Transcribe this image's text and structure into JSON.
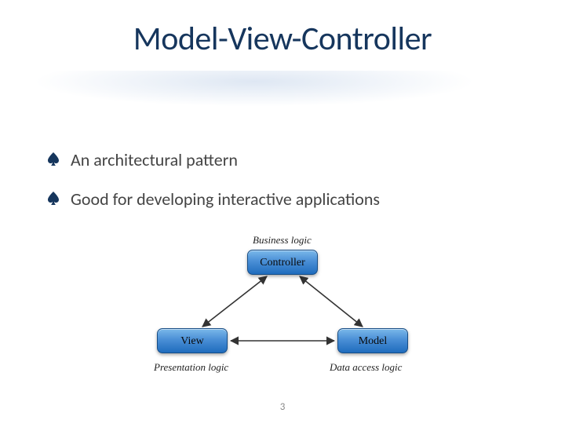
{
  "title": "Model-View-Controller",
  "bullets": [
    "An architectural pattern",
    "Good for developing interactive applications"
  ],
  "diagram": {
    "top_label": "Business logic",
    "controller": "Controller",
    "view": "View",
    "model": "Model",
    "view_label": "Presentation logic",
    "model_label": "Data access logic"
  },
  "page_number": "3"
}
